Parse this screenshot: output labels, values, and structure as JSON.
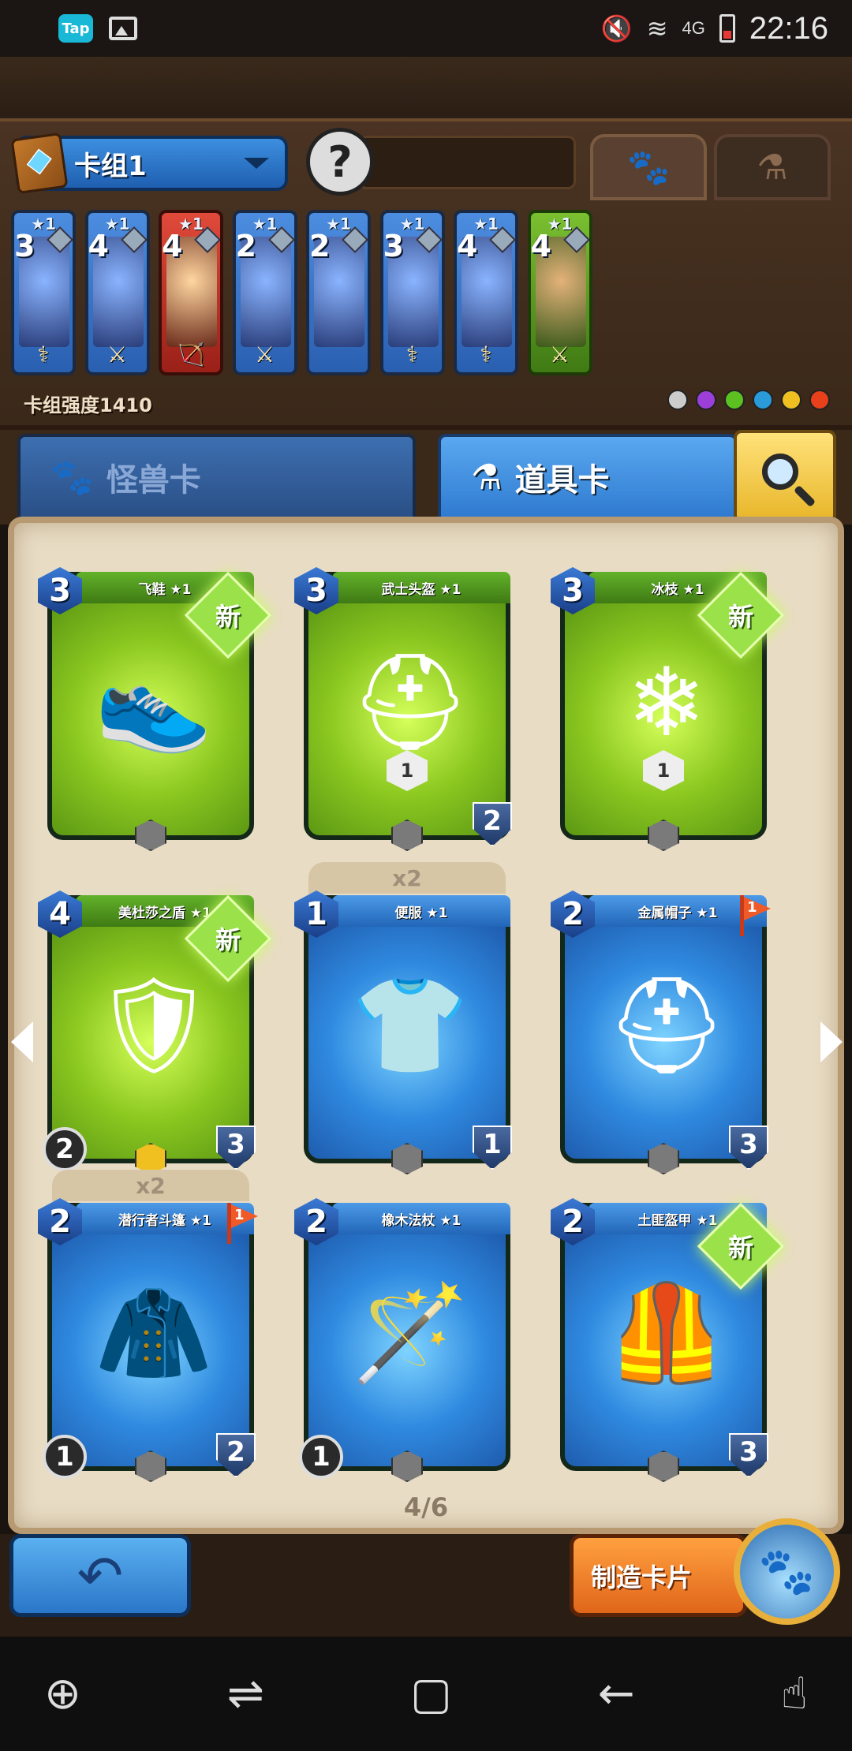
{
  "status_bar": {
    "app_badge": "Tap",
    "time": "22:16",
    "network": "4G"
  },
  "deck": {
    "name": "卡组1",
    "hero_placeholder": "?",
    "strength_label": "卡组强度1410",
    "tab_monster_icon": "paw-icon",
    "tab_item_icon": "potion-icon",
    "cards": [
      {
        "stars": "★1",
        "cost": "3",
        "color": "blue",
        "weapon": "staff-icon"
      },
      {
        "stars": "★1",
        "cost": "4",
        "color": "blue",
        "weapon": "sword-icon"
      },
      {
        "stars": "★1",
        "cost": "4",
        "color": "red",
        "weapon": "bow-icon"
      },
      {
        "stars": "★1",
        "cost": "2",
        "color": "blue",
        "weapon": "sword-icon"
      },
      {
        "stars": "★1",
        "cost": "2",
        "color": "blue",
        "weapon": ""
      },
      {
        "stars": "★1",
        "cost": "3",
        "color": "blue",
        "weapon": "staff-icon"
      },
      {
        "stars": "★1",
        "cost": "4",
        "color": "blue",
        "weapon": "staff-icon"
      },
      {
        "stars": "★1",
        "cost": "4",
        "color": "green",
        "weapon": "sword-icon"
      }
    ],
    "element_colors": [
      "#cccccc",
      "#9b3fd8",
      "#5cc020",
      "#2a9ad8",
      "#f0c020",
      "#e8401a"
    ]
  },
  "category_tabs": {
    "monster": "怪兽卡",
    "item": "道具卡"
  },
  "cards": [
    {
      "name": "飞鞋 ★1",
      "cost": "3",
      "color": "green",
      "badge": "新",
      "art": "👟",
      "center": "",
      "shield": "",
      "left": "",
      "copies": ""
    },
    {
      "name": "武士头盔 ★1",
      "cost": "3",
      "color": "green",
      "badge": "",
      "art": "⛑",
      "center": "1",
      "shield": "2",
      "left": "",
      "copies": ""
    },
    {
      "name": "冰枝 ★1",
      "cost": "3",
      "color": "green",
      "badge": "新",
      "art": "❄",
      "center": "1",
      "shield": "",
      "left": "",
      "copies": ""
    },
    {
      "name": "美杜莎之盾 ★1",
      "cost": "4",
      "color": "green",
      "badge": "新",
      "art": "🛡",
      "center": "",
      "shield": "3",
      "left": "2",
      "copies": ""
    },
    {
      "name": "便服 ★1",
      "cost": "1",
      "color": "blue",
      "badge": "",
      "art": "👕",
      "center": "",
      "shield": "1",
      "left": "",
      "copies": "x2"
    },
    {
      "name": "金属帽子 ★1",
      "cost": "2",
      "color": "blue",
      "badge": "",
      "flag": "1",
      "art": "⛑",
      "center": "",
      "shield": "3",
      "left": "",
      "copies": ""
    },
    {
      "name": "潜行者斗篷 ★1",
      "cost": "2",
      "color": "blue",
      "badge": "",
      "flag": "1",
      "art": "🧥",
      "center": "",
      "shield": "2",
      "left": "1",
      "copies": "x2"
    },
    {
      "name": "橡木法杖 ★1",
      "cost": "2",
      "color": "blue",
      "badge": "",
      "art": "🪄",
      "center": "",
      "shield": "",
      "left": "1",
      "copies": ""
    },
    {
      "name": "土匪盔甲 ★1",
      "cost": "2",
      "color": "blue",
      "badge": "新",
      "art": "🦺",
      "center": "",
      "shield": "3",
      "left": "",
      "copies": ""
    }
  ],
  "page_indicator": "4/6",
  "buttons": {
    "back": "↶",
    "craft": "制造卡片"
  }
}
